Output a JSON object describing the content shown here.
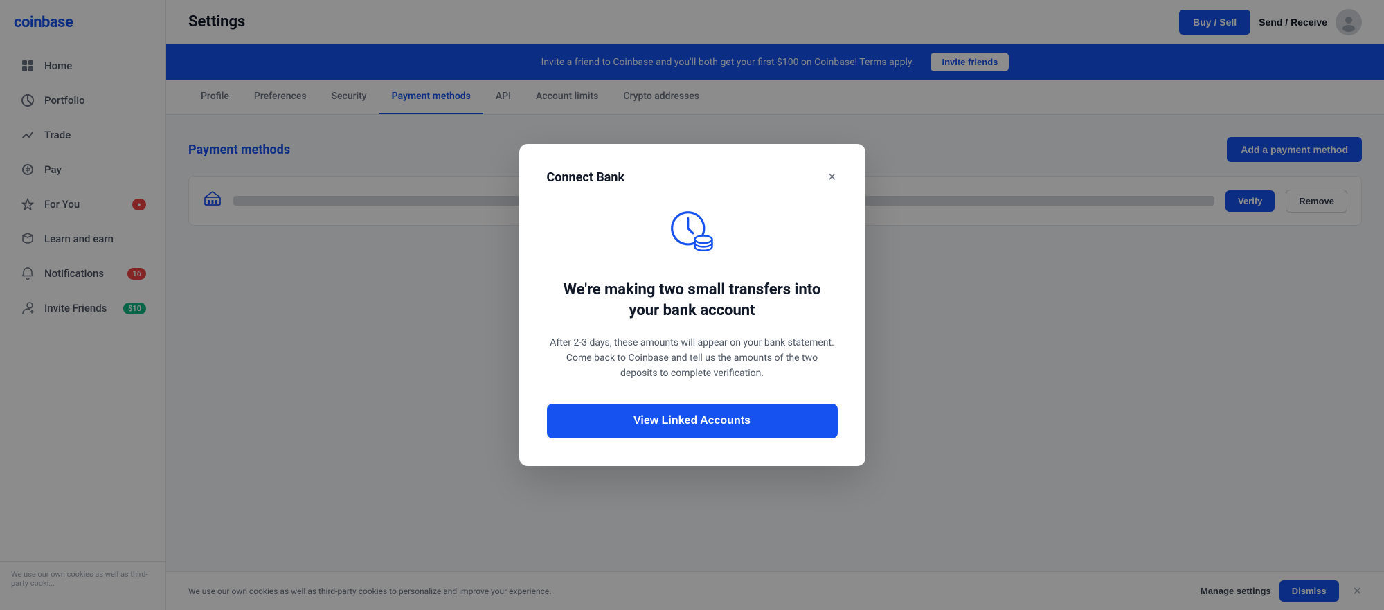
{
  "logo": {
    "text": "coinbase"
  },
  "sidebar": {
    "items": [
      {
        "id": "home",
        "label": "Home",
        "icon": "grid-icon",
        "badge": null
      },
      {
        "id": "portfolio",
        "label": "Portfolio",
        "icon": "portfolio-icon",
        "badge": null
      },
      {
        "id": "trade",
        "label": "Trade",
        "icon": "trade-icon",
        "badge": null
      },
      {
        "id": "pay",
        "label": "Pay",
        "icon": "pay-icon",
        "badge": null
      },
      {
        "id": "for-you",
        "label": "For You",
        "icon": "star-icon",
        "badge": "●"
      },
      {
        "id": "learn",
        "label": "Learn and earn",
        "icon": "learn-icon",
        "badge": null
      },
      {
        "id": "notifications",
        "label": "Notifications",
        "icon": "bell-icon",
        "badge": "16"
      },
      {
        "id": "invite",
        "label": "Invite Friends",
        "icon": "invite-icon",
        "badge": "$10"
      }
    ]
  },
  "sidebar_footer": {
    "text": "We use our own cookies as well as third-party cooki..."
  },
  "header": {
    "title": "Settings",
    "buy_sell_label": "Buy / Sell",
    "send_receive_label": "Send / Receive"
  },
  "banner": {
    "text": "Invite a friend to Coinbase and you'll both get your first $100 on Coinbase! Terms apply.",
    "button_label": "Invite friends"
  },
  "tabs": [
    {
      "id": "profile",
      "label": "Profile"
    },
    {
      "id": "preferences",
      "label": "Preferences"
    },
    {
      "id": "security",
      "label": "Security"
    },
    {
      "id": "payment-methods",
      "label": "Payment methods",
      "active": true
    },
    {
      "id": "api",
      "label": "API"
    },
    {
      "id": "account-limits",
      "label": "Account limits"
    },
    {
      "id": "crypto-addresses",
      "label": "Crypto addresses"
    }
  ],
  "payment_methods": {
    "section_title": "Payment methods",
    "add_button_label": "Add a payment method",
    "bank_item": {
      "icon": "bank-icon",
      "verify_label": "Verify",
      "remove_label": "Remove"
    }
  },
  "cookie_bar": {
    "text": "We use our own cookies as well as third-party cookies to personalize and improve your experience.",
    "manage_label": "Manage settings",
    "dismiss_label": "Dismiss"
  },
  "modal": {
    "title": "Connect Bank",
    "close_label": "×",
    "heading": "We're making two small transfers into your bank account",
    "body": "After 2-3 days, these amounts will appear on your bank statement. Come back to Coinbase and tell us the amounts of the two deposits to complete verification.",
    "cta_label": "View Linked Accounts",
    "icon_color": "#1652f0"
  }
}
